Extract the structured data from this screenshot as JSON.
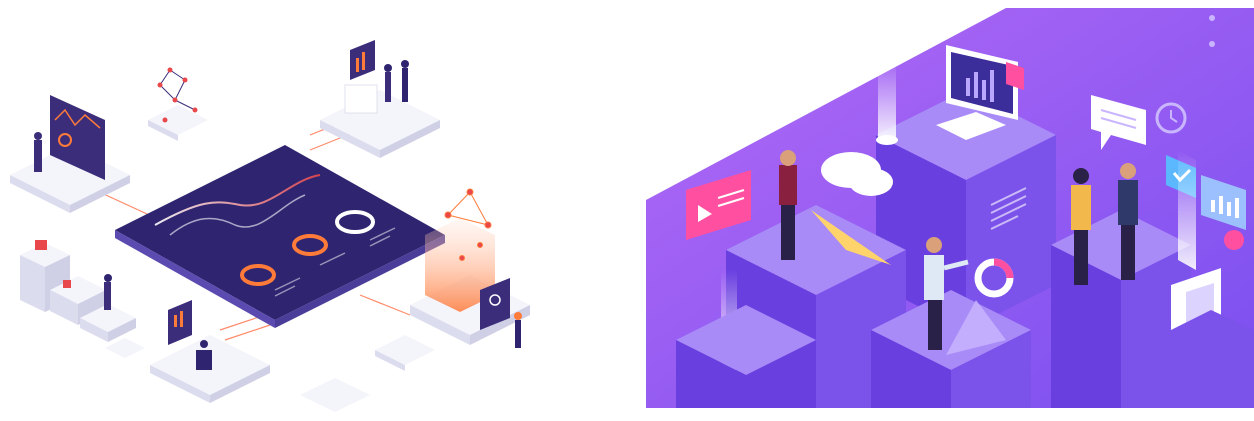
{
  "colors": {
    "dashboard_dark": "#3b2d7a",
    "dashboard_edge": "#5b4bb0",
    "platform_top": "#f4f4fb",
    "platform_side": "#dcdcef",
    "accent_orange": "#ff7b3a",
    "accent_red": "#e8474b",
    "accent_pink": "#ff4fa0",
    "purple_bg": "#9a5cf2",
    "purple_deep": "#6a3fe0",
    "purple_block": "#7b52ea",
    "purple_top": "#a98bf8",
    "sky_cloud": "#ffffff"
  },
  "icons": {
    "left": [
      "network-node-icon",
      "donut-chart-icon",
      "line-chart-icon",
      "monitor-icon",
      "person-icon"
    ],
    "right": [
      "monitor-icon",
      "cloud-icon",
      "play-icon",
      "chat-bubble-icon",
      "clock-icon",
      "check-icon",
      "bar-chart-icon",
      "donut-chart-icon",
      "server-icon"
    ]
  }
}
